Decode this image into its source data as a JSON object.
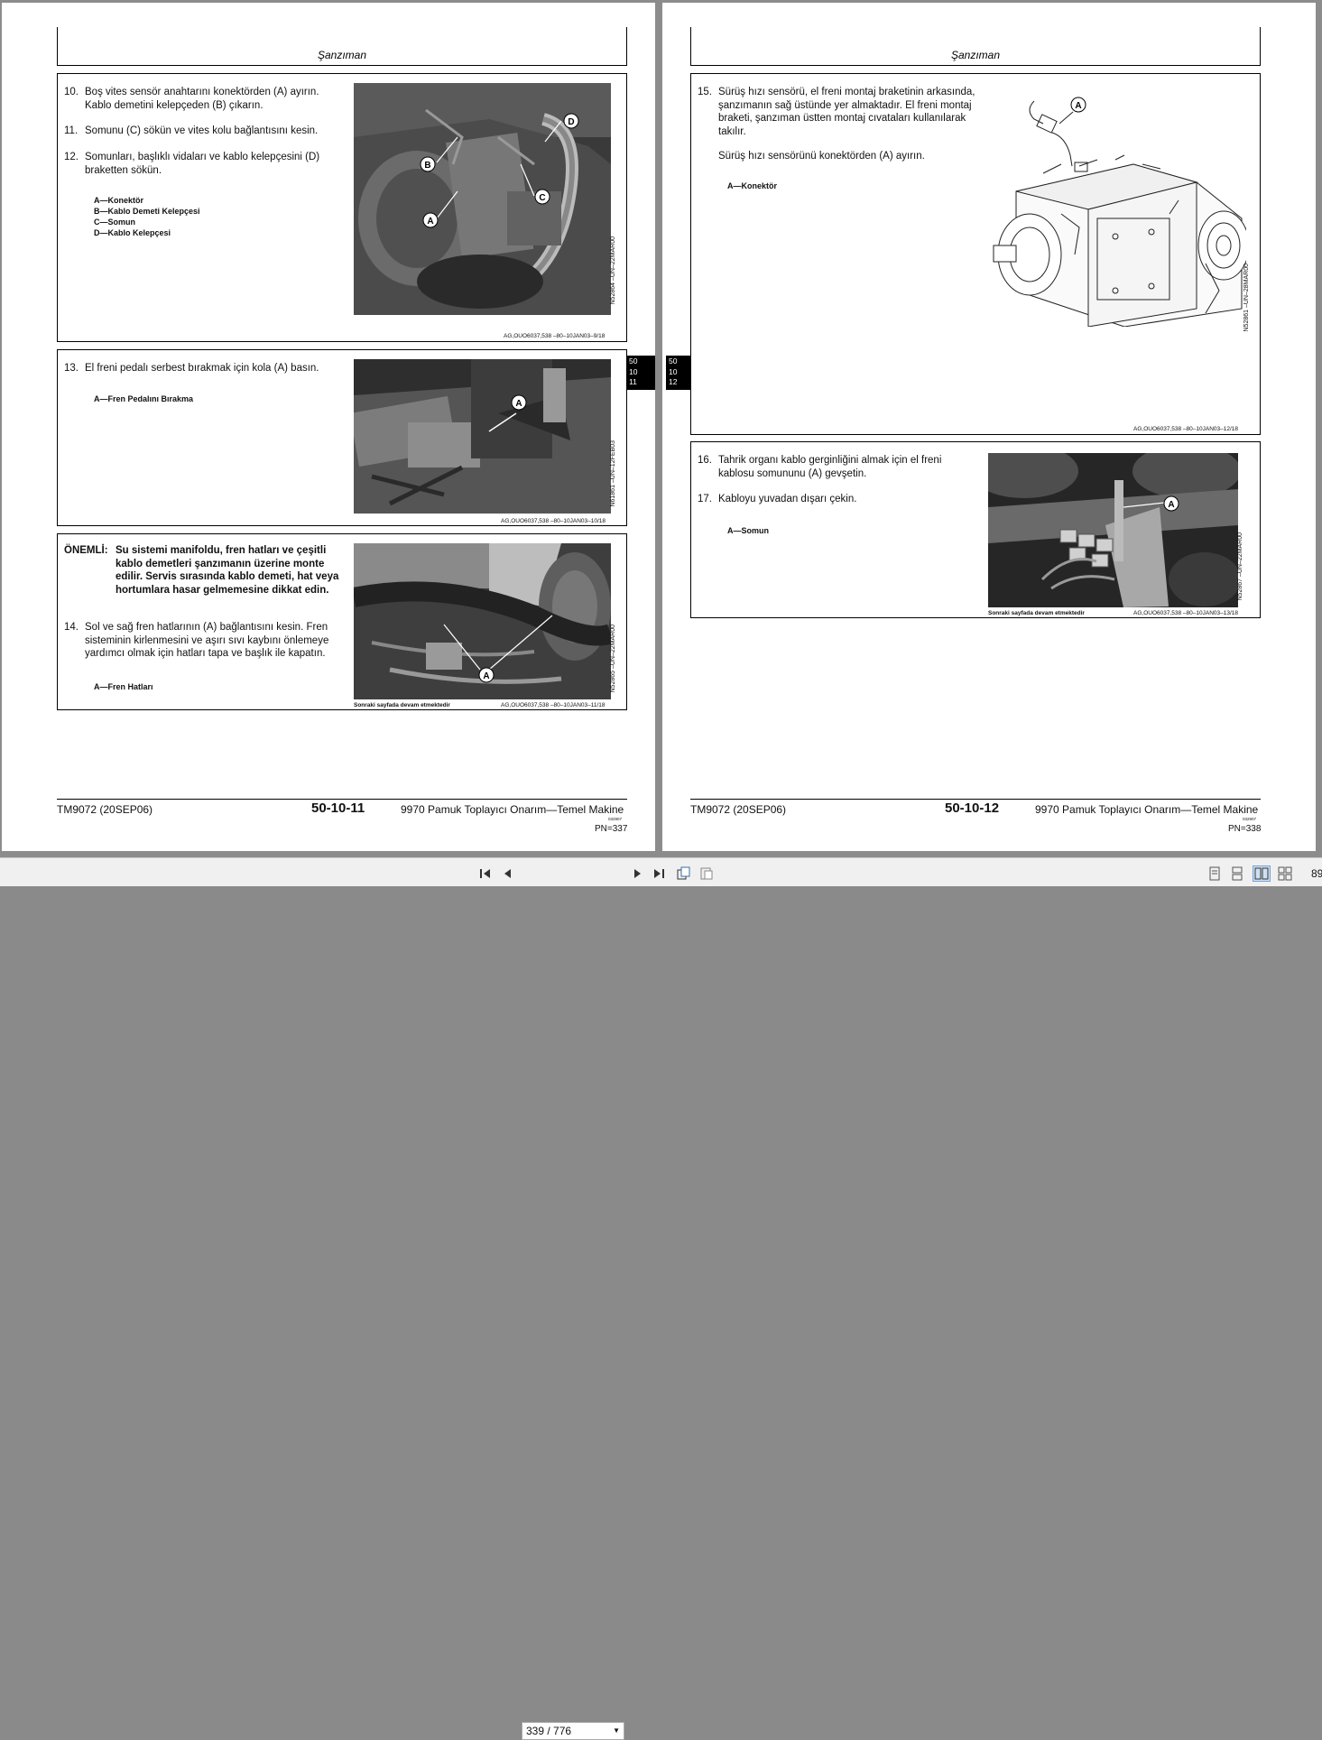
{
  "left_page": {
    "header": "Şanzıman",
    "box1": {
      "steps": [
        {
          "num": "10.",
          "text": "Boş vites sensör anahtarını konektörden (A) ayırın. Kablo demetini kelepçeden (B) çıkarın."
        },
        {
          "num": "11.",
          "text": "Somunu (C) sökün ve vites kolu bağlantısını kesin."
        },
        {
          "num": "12.",
          "text": "Somunları, başlıklı vidaları ve kablo kelepçesini (D) braketten sökün."
        }
      ],
      "legend": [
        "A—Konektör",
        "B—Kablo Demeti Kelepçesi",
        "C—Somun",
        "D—Kablo Kelepçesi"
      ],
      "photo_code": "N52864 –UN–22MAR00",
      "callouts": [
        "B",
        "A",
        "D",
        "C"
      ],
      "ref": "AG,OUO6037,538    –80–10JAN03–9/18"
    },
    "box2": {
      "steps": [
        {
          "num": "13.",
          "text": "El freni pedalı serbest bırakmak için kola (A) basın."
        }
      ],
      "legend": [
        "A—Fren Pedalını Bırakma"
      ],
      "photo_code": "N61861 –UN–12FEB03",
      "callouts": [
        "A"
      ],
      "ref": "AG,OUO6037,538    –80–10JAN03–10/18"
    },
    "box3": {
      "important_label": "ÖNEMLİ:",
      "important_text": "Su sistemi manifoldu, fren hatları ve çeşitli kablo demetleri şanzımanın üzerine monte edilir. Servis sırasında kablo demeti, hat veya hortumlara hasar gelmemesine dikkat edin.",
      "steps": [
        {
          "num": "14.",
          "text": "Sol ve sağ fren hatlarının (A) bağlantısını kesin. Fren sisteminin kirlenmesini ve aşırı sıvı kaybını önlemeye yardımcı olmak için hatları tapa ve başlık ile kapatın."
        }
      ],
      "legend": [
        "A—Fren Hatları"
      ],
      "photo_code": "N52865 –UN–22MAR00",
      "callouts": [
        "A"
      ],
      "continued": "Sonraki sayfada devam etmektedir",
      "ref": "AG,OUO6037,538    –80–10JAN03–11/18"
    },
    "tab": [
      "50",
      "10",
      "11"
    ],
    "footer": {
      "doc": "TM9072 (20SEP06)",
      "page_num": "50-10-11",
      "title": "9970 Pamuk Toplayıcı Onarım—Temel Makine",
      "small": "032907",
      "pn": "PN=337"
    }
  },
  "right_page": {
    "header": "Şanzıman",
    "box1": {
      "steps": [
        {
          "num": "15.",
          "text": "Sürüş hızı sensörü, el freni montaj braketinin arkasında, şanzımanın sağ üstünde yer almaktadır. El freni montaj braketi, şanzıman üstten montaj cıvataları kullanılarak takılır."
        }
      ],
      "extra": "Sürüş hızı sensörünü konektörden (A) ayırın.",
      "legend": [
        "A—Konektör"
      ],
      "photo_code": "N52861 –UN–28MAR00",
      "callouts": [
        "A"
      ],
      "ref": "AG,OUO6037,538    –80–10JAN03–12/18"
    },
    "box2": {
      "steps": [
        {
          "num": "16.",
          "text": "Tahrik organı kablo gerginliğini almak için el freni kablosu somununu (A) gevşetin."
        },
        {
          "num": "17.",
          "text": "Kabloyu yuvadan dışarı çekin."
        }
      ],
      "legend": [
        "A—Somun"
      ],
      "photo_code": "N52867 –UN–22MAR00",
      "callouts": [
        "A"
      ],
      "continued": "Sonraki sayfada devam etmektedir",
      "ref": "AG,OUO6037,538    –80–10JAN03–13/18"
    },
    "tab": [
      "50",
      "10",
      "12"
    ],
    "footer": {
      "doc": "TM9072 (20SEP06)",
      "page_num": "50-10-12",
      "title": "9970 Pamuk Toplayıcı Onarım—Temel Makine",
      "small": "032907",
      "pn": "PN=338"
    }
  },
  "toolbar": {
    "page_field": "339 / 776",
    "zoom": "89",
    "icons": [
      "first-page-icon",
      "prev-page-icon",
      "next-page-icon",
      "last-page-icon",
      "rotate-icon",
      "fit-page-icon",
      "single-page-icon",
      "continuous-icon",
      "two-page-icon",
      "two-page-continuous-icon"
    ]
  }
}
